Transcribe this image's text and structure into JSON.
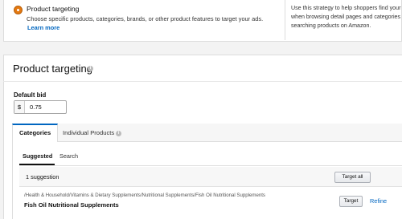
{
  "option": {
    "title": "Product targeting",
    "description": "Choose specific products, categories, brands, or other product features to target your ads.",
    "learn_more": "Learn more",
    "strategy_line1": "Use this strategy to help shoppers find your prod",
    "strategy_line2": "when browsing detail pages and categories or",
    "strategy_line3": "searching products on Amazon."
  },
  "panel": {
    "title": "Product targeting",
    "default_bid_label": "Default bid",
    "currency_symbol": "$",
    "default_bid_value": "0.75"
  },
  "tabs": {
    "categories": "Categories",
    "individual_products": "Individual Products"
  },
  "subtabs": {
    "suggested": "Suggested",
    "search": "Search"
  },
  "suggestions": {
    "count_text": "1 suggestion",
    "target_all": "Target all",
    "items": [
      {
        "path": "/Health & Household/Vitamins & Dietary Supplements/Nutritional Supplements/Fish Oil Nutritional Supplements",
        "name": "Fish Oil Nutritional Supplements",
        "target_label": "Target",
        "refine_label": "Refine"
      }
    ]
  },
  "colors": {
    "radio_selected": "#e47911",
    "link": "#0066c0",
    "active_tab_border": "#0066c0"
  },
  "icons": {
    "info": "info-icon",
    "radio": "radio-selected-icon"
  }
}
